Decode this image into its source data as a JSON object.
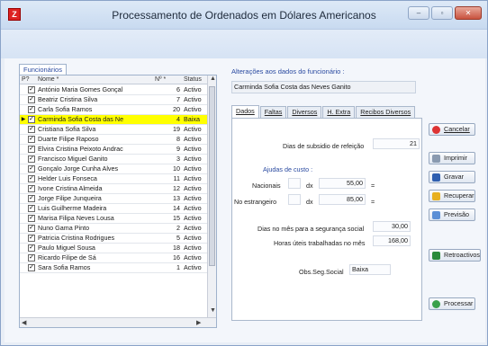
{
  "window": {
    "title": "Processamento de Ordenados em Dólares Americanos",
    "app_icon": "Z"
  },
  "left_panel": {
    "tab_label": "Funcionários",
    "columns": [
      "P?",
      "Nome *",
      "Nº *",
      "Status"
    ],
    "rows": [
      {
        "name": "António Maria Gomes Gonçal",
        "no": "6",
        "status": "Activo",
        "checked": true,
        "selected": false
      },
      {
        "name": "Beatriz Cristina Silva",
        "no": "7",
        "status": "Activo",
        "checked": true,
        "selected": false
      },
      {
        "name": "Carla Sofia Ramos",
        "no": "20",
        "status": "Activo",
        "checked": true,
        "selected": false
      },
      {
        "name": "Carminda Sofia Costa das Ne",
        "no": "4",
        "status": "Baixa",
        "checked": true,
        "selected": true
      },
      {
        "name": "Cristiana Sofia Silva",
        "no": "19",
        "status": "Activo",
        "checked": true,
        "selected": false
      },
      {
        "name": "Duarte Filipe Raposo",
        "no": "8",
        "status": "Activo",
        "checked": true,
        "selected": false
      },
      {
        "name": "Elvira Cristina Peixoto Andrac",
        "no": "9",
        "status": "Activo",
        "checked": true,
        "selected": false
      },
      {
        "name": "Francisco Miguel Ganito",
        "no": "3",
        "status": "Activo",
        "checked": true,
        "selected": false
      },
      {
        "name": "Gonçalo Jorge Cunha Alves",
        "no": "10",
        "status": "Activo",
        "checked": true,
        "selected": false
      },
      {
        "name": "Helder Luis Fonseca",
        "no": "11",
        "status": "Activo",
        "checked": true,
        "selected": false
      },
      {
        "name": "Ivone Cristina Almeida",
        "no": "12",
        "status": "Activo",
        "checked": true,
        "selected": false
      },
      {
        "name": "Jorge Filipe Junqueira",
        "no": "13",
        "status": "Activo",
        "checked": true,
        "selected": false
      },
      {
        "name": "Luis Guilherme Madeira",
        "no": "14",
        "status": "Activo",
        "checked": true,
        "selected": false
      },
      {
        "name": "Marisa Filipa Neves Lousa",
        "no": "15",
        "status": "Activo",
        "checked": true,
        "selected": false
      },
      {
        "name": "Nuno Gama Pinto",
        "no": "2",
        "status": "Activo",
        "checked": true,
        "selected": false
      },
      {
        "name": "Patricia Cristina Rodrigues",
        "no": "5",
        "status": "Activo",
        "checked": true,
        "selected": false
      },
      {
        "name": "Paulo Miguel Sousa",
        "no": "18",
        "status": "Activo",
        "checked": true,
        "selected": false
      },
      {
        "name": "Ricardo Filipe de Sá",
        "no": "16",
        "status": "Activo",
        "checked": true,
        "selected": false
      },
      {
        "name": "Sara Sofia Ramos",
        "no": "1",
        "status": "Activo",
        "checked": true,
        "selected": false
      }
    ]
  },
  "right_panel": {
    "section_label": "Alterações aos dados do funcionário :",
    "employee_name": "Carminda Sofia Costa das Neves Ganito",
    "tabs": [
      "Dados",
      "Faltas",
      "Diversos",
      "H. Extra",
      "Recibos Diversos"
    ],
    "active_tab": "Dados",
    "subsidio_label": "Dias de subsidio de refeição",
    "subsidio_value": "21",
    "ajudas_label": "Ajudas de custo :",
    "nacionais_label": "Nacionais",
    "nacionais_mult": "dx",
    "nacionais_value": "55,00",
    "nacionais_eq": "=",
    "estrangeiro_label": "No estrangeiro",
    "estrangeiro_mult": "dx",
    "estrangeiro_value": "85,00",
    "estrangeiro_eq": "=",
    "seg_social_label": "Dias no mês para a segurança social",
    "seg_social_value": "30,00",
    "horas_label": "Horas úteis trabalhadas no mês",
    "horas_value": "168,00",
    "obs_label": "Obs.Seg.Social",
    "obs_value": "Baixa"
  },
  "buttons": {
    "cancelar": "Cancelar",
    "imprimir": "Imprimir",
    "gravar": "Gravar",
    "recuperar": "Recuperar",
    "previsao": "Previsão",
    "retroactivos": "Retroactivos",
    "processar": "Processar"
  }
}
